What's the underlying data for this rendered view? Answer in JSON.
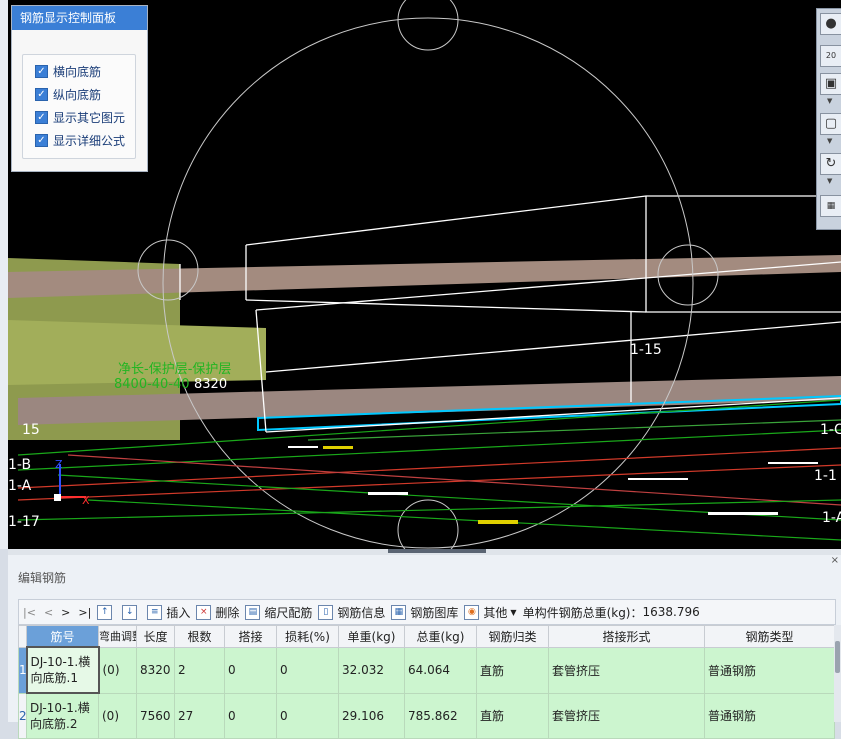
{
  "control_panel": {
    "title": "钢筋显示控制面板",
    "options": [
      {
        "label": "横向底筋",
        "checked": true
      },
      {
        "label": "纵向底筋",
        "checked": true
      },
      {
        "label": "显示其它图元",
        "checked": true
      },
      {
        "label": "显示详细公式",
        "checked": true
      }
    ]
  },
  "viewport": {
    "dimension_line1": "净长-保护层-保护层",
    "dimension_line2": "8400-40-40",
    "dimension_value": "8320",
    "axis_labels": [
      "1-15",
      "15",
      "1-B",
      "1-A",
      "1-17",
      "1-15",
      "1-C",
      "1-1",
      "1-A"
    ],
    "axes": {
      "z": "Z",
      "x": "X"
    }
  },
  "right_toolbar": {
    "zoom_label": "20"
  },
  "editor": {
    "title": "编辑钢筋",
    "toolbar": {
      "nav": [
        "|<",
        "<",
        ">",
        ">|"
      ],
      "insert": "插入",
      "delete": "删除",
      "scale_bar": "缩尺配筋",
      "rebar_info": "钢筋信息",
      "rebar_library": "钢筋图库",
      "other": "其他",
      "total_weight_label": "单构件钢筋总重(kg)：",
      "total_weight_value": "1638.796"
    },
    "columns": [
      "筋号",
      "弯曲调整",
      "长度",
      "根数",
      "搭接",
      "损耗(%)",
      "单重(kg)",
      "总重(kg)",
      "钢筋归类",
      "搭接形式",
      "钢筋类型"
    ],
    "rows": [
      {
        "num": "1",
        "code": "DJ-10-1.横向底筋.1",
        "bend": "(0)",
        "length": "8320",
        "count": "2",
        "lap": "0",
        "loss": "0",
        "unit_weight": "32.032",
        "total_weight": "64.064",
        "category": "直筋",
        "lap_form": "套管挤压",
        "type": "普通钢筋"
      },
      {
        "num": "2",
        "code": "DJ-10-1.横向底筋.2",
        "bend": "(0)",
        "length": "7560",
        "count": "27",
        "lap": "0",
        "loss": "0",
        "unit_weight": "29.106",
        "total_weight": "785.862",
        "category": "直筋",
        "lap_form": "套管挤压",
        "type": "普通钢筋"
      }
    ]
  }
}
